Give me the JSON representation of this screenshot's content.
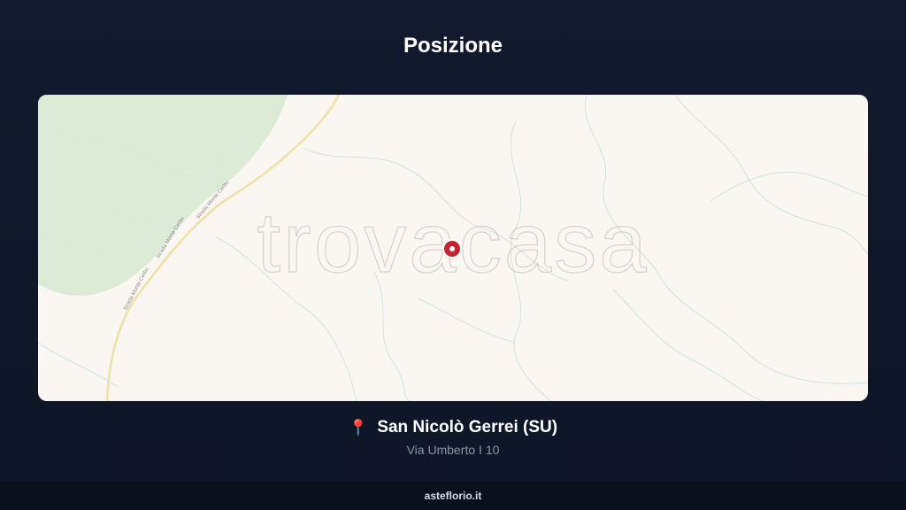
{
  "page": {
    "title": "Posizione"
  },
  "map": {
    "watermark": "trovacasa",
    "road_labels": [
      "Strada Monte Cerbu",
      "Strada Monte Cerbu",
      "Strada Monte Cerbu"
    ],
    "marker_icon": "map-marker-icon"
  },
  "location": {
    "icon": "pushpin-icon",
    "name": "San Nicolò Gerrei (SU)",
    "address": "Via Umberto I 10"
  },
  "footer": {
    "brand": "asteflorio.it"
  },
  "colors": {
    "background": "#111b2d",
    "map_land": "#faf7f3",
    "map_forest": "#dcebd6",
    "marker": "#c3242f"
  }
}
